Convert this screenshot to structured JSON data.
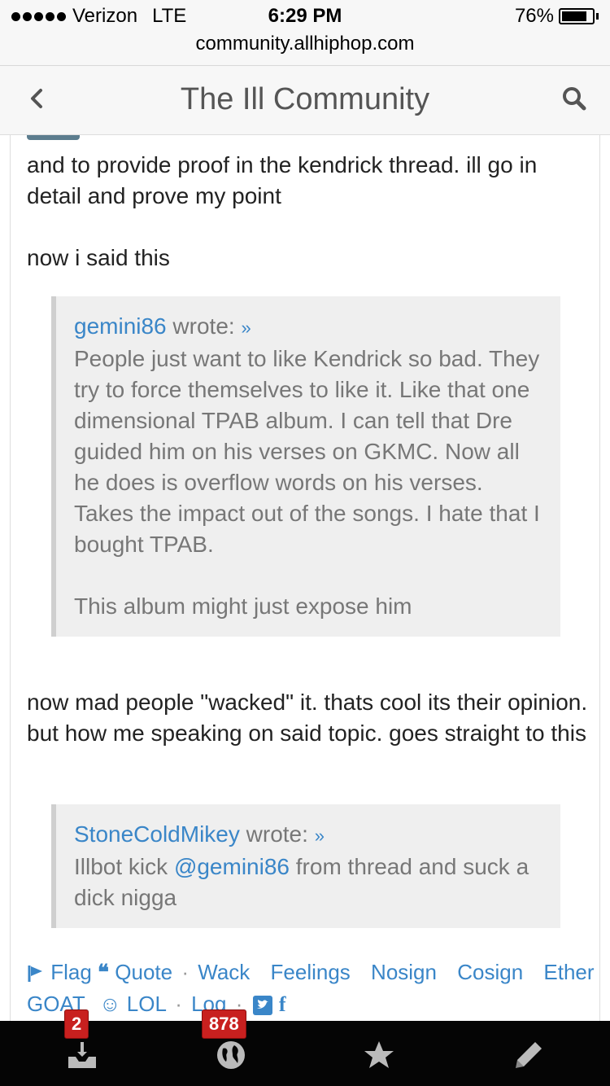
{
  "status_bar": {
    "carrier": "Verizon",
    "network": "LTE",
    "time": "6:29 PM",
    "battery": "76%",
    "url": "community.allhiphop.com"
  },
  "nav": {
    "title": "The Ill Community",
    "back_icon": "chevron-left-icon",
    "search_icon": "search-icon"
  },
  "post": {
    "intro": "and to provide proof in the kendrick thread. ill go in detail and prove my point",
    "said_this": "now i said this",
    "quote1": {
      "author": "gemini86",
      "wrote": "wrote:",
      "jump": "»",
      "body": "People just want to like Kendrick so bad. They try to force themselves to like it. Like that one dimensional TPAB album. I can tell that Dre guided him on his verses on GKMC. Now all he does is overflow words on his verses. Takes the impact out of the songs. I hate that I bought TPAB.",
      "body2": "This album might just expose him"
    },
    "followup": "now mad people \"wacked\" it. thats cool its their opinion. but how me speaking on said topic. goes straight to this",
    "quote2": {
      "author": "StoneColdMikey",
      "wrote": "wrote:",
      "jump": "»",
      "prefix": "Illbot kick",
      "mention": "@gemini86",
      "suffix": "from thread and suck a dick nigga"
    }
  },
  "actions": {
    "flag": "Flag",
    "quote": "Quote",
    "sep": "·",
    "wack": "Wack",
    "feelings": "Feelings",
    "nosign": "Nosign",
    "cosign": "Cosign",
    "ether": "Ether",
    "goat": "GOAT",
    "lol": "LOL",
    "log": "Log"
  },
  "tabbar": {
    "inbox_badge": "2",
    "activity_badge": "878",
    "icons": [
      "inbox-icon",
      "globe-icon",
      "star-icon",
      "pencil-icon"
    ]
  },
  "colors": {
    "link": "#3a86c8",
    "badge": "#c8201f",
    "tabbar": "#050505"
  }
}
